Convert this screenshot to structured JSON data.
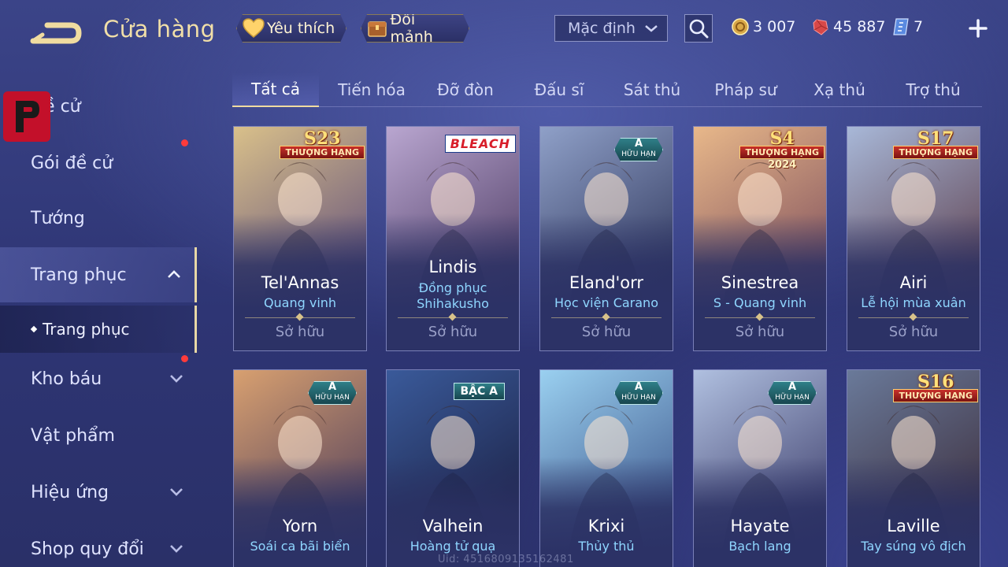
{
  "header": {
    "title": "Cửa hàng",
    "favorite_label": "Yêu thích",
    "trade_label": "Đổi mảnh",
    "sort_value": "Mặc định",
    "currencies": [
      {
        "icon": "gold-coin-icon",
        "value": "3 007"
      },
      {
        "icon": "ruby-icon",
        "value": "45 887"
      },
      {
        "icon": "voucher-icon",
        "value": "7"
      }
    ]
  },
  "sidebar": {
    "items": [
      {
        "label": "Đề cử"
      },
      {
        "label": "Gói đề cử",
        "notify": true
      },
      {
        "label": "Tướng"
      },
      {
        "label": "Trang phục",
        "expanded": true
      },
      {
        "label": "Trang phục",
        "sub": true
      },
      {
        "label": "Kho báu",
        "notify": true
      },
      {
        "label": "Vật phẩm"
      },
      {
        "label": "Hiệu ứng"
      },
      {
        "label": "Shop quy đổi"
      }
    ]
  },
  "tabs": [
    "Tất cả",
    "Tiến hóa",
    "Đỡ đòn",
    "Đấu sĩ",
    "Sát thủ",
    "Pháp sư",
    "Xạ thủ",
    "Trợ thủ"
  ],
  "active_tab": "Tất cả",
  "cards": [
    {
      "name": "Tel'Annas",
      "sub1": "Quang vinh",
      "sub2": "",
      "owned": "Sở hữu",
      "badge": "S23",
      "badge_sub": "THƯỢNG HẠNG",
      "colors": [
        "#d9c08a",
        "#5c4a7a"
      ]
    },
    {
      "name": "Lindis",
      "sub1": "Đồng phục",
      "sub2": "Shihakusho",
      "owned": "Sở hữu",
      "badge": "BLEACH",
      "badge_sub": "",
      "colors": [
        "#b9a6d0",
        "#4a3860"
      ]
    },
    {
      "name": "Eland'orr",
      "sub1": "Học viện Carano",
      "sub2": "",
      "owned": "Sở hữu",
      "badge": "A",
      "badge_sub": "HỮU HẠN",
      "colors": [
        "#8fa0c8",
        "#2c3358"
      ]
    },
    {
      "name": "Sinestrea",
      "sub1": "S - Quang vinh",
      "sub2": "",
      "owned": "Sở hữu",
      "badge": "S4",
      "badge_sub": "THƯỢNG HẠNG",
      "badge_sub2": "2024",
      "colors": [
        "#e8b88a",
        "#7a4a5a"
      ]
    },
    {
      "name": "Airi",
      "sub1": "Lễ hội mùa xuân",
      "sub2": "",
      "owned": "Sở hữu",
      "badge": "S17",
      "badge_sub": "THƯỢNG HẠNG",
      "colors": [
        "#a8b8d8",
        "#5a3a48"
      ]
    },
    {
      "name": "Yorn",
      "sub1": "Soái ca bãi biển",
      "sub2": "",
      "owned": "",
      "badge": "A",
      "badge_sub": "HỮU HẠN",
      "colors": [
        "#d8a070",
        "#4a3a5a"
      ]
    },
    {
      "name": "Valhein",
      "sub1": "Hoàng tử quạ",
      "sub2": "",
      "owned": "",
      "badge": "BẬC A",
      "badge_sub": "",
      "colors": [
        "#3a5a9a",
        "#1a1e40"
      ]
    },
    {
      "name": "Krixi",
      "sub1": "Thủy thủ",
      "sub2": "",
      "owned": "",
      "badge": "A",
      "badge_sub": "HỮU HẠN",
      "colors": [
        "#9ad0f0",
        "#3a5288"
      ]
    },
    {
      "name": "Hayate",
      "sub1": "Bạch lang",
      "sub2": "",
      "owned": "",
      "badge": "A",
      "badge_sub": "HỮU HẠN",
      "colors": [
        "#b0c0e0",
        "#3a3a68"
      ]
    },
    {
      "name": "Laville",
      "sub1": "Tay súng vô địch",
      "sub2": "",
      "owned": "",
      "badge": "S16",
      "badge_sub": "THƯỢNG HẠNG",
      "colors": [
        "#6a7a9a",
        "#3a2a38"
      ]
    }
  ],
  "footer": {
    "uid": "Uid: 4516809135162481"
  },
  "theme": {
    "accent": "#f0dca0",
    "notify": "#ff3b3b",
    "subtitle": "#8fd6ff"
  }
}
